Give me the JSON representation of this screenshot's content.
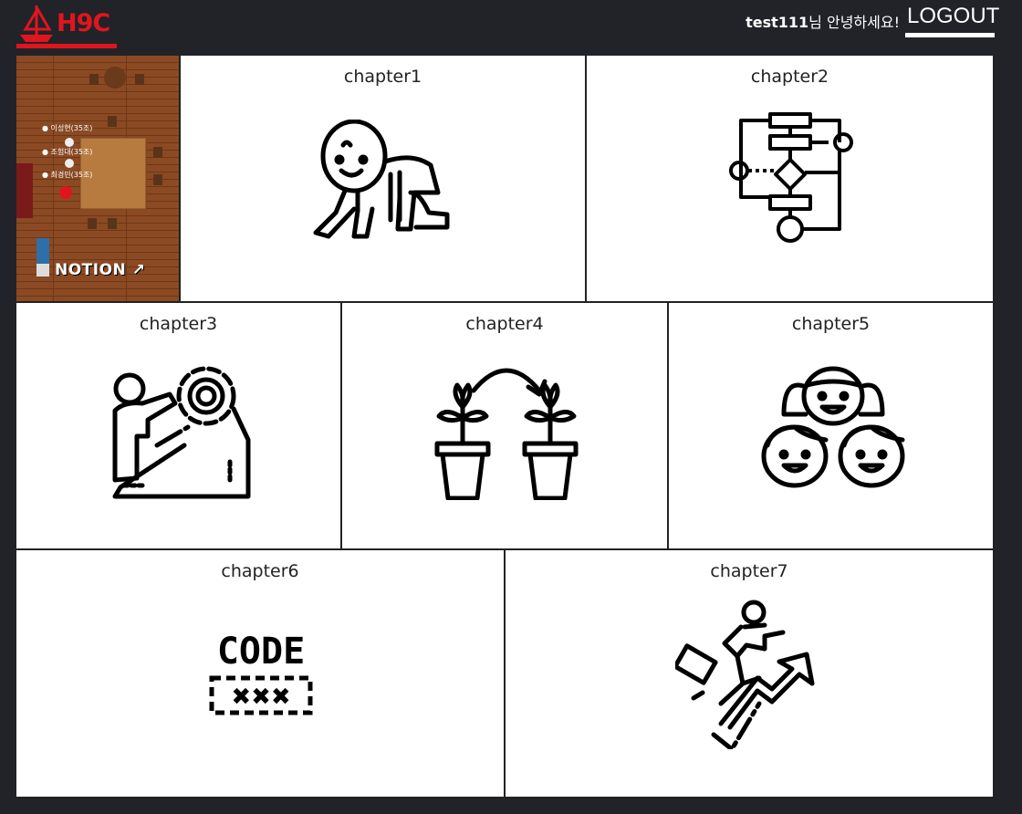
{
  "header": {
    "brand": "H9C",
    "username": "test111",
    "greeting_suffix": "님 안녕하세요!",
    "logout_label": "LOGOUT"
  },
  "map_panel": {
    "notion_label": "NOTION",
    "players": [
      "이성현(35조)",
      "조험대(35조)",
      "최경민(35조)"
    ]
  },
  "chapters": [
    {
      "label": "chapter1",
      "icon": "crawling-baby-icon"
    },
    {
      "label": "chapter2",
      "icon": "flowchart-icon"
    },
    {
      "label": "chapter3",
      "icon": "person-gear-climb-icon"
    },
    {
      "label": "chapter4",
      "icon": "plant-transfer-icon"
    },
    {
      "label": "chapter5",
      "icon": "kids-faces-icon"
    },
    {
      "label": "chapter6",
      "icon": "code-icon"
    },
    {
      "label": "chapter7",
      "icon": "businessman-growth-icon"
    }
  ],
  "icon_code_text": "CODE",
  "colors": {
    "accent": "#e0151f",
    "background": "#212328"
  }
}
